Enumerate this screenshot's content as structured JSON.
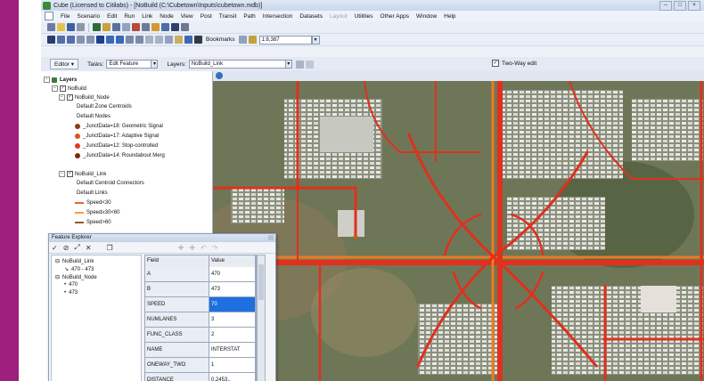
{
  "window": {
    "title": "Cube (Licensed to Citilabs) - [NoBuild (C:\\Cubetown\\Inputs\\cubetown.mdb)]"
  },
  "menu": [
    "File",
    "Scenario",
    "Edit",
    "Run",
    "Link",
    "Node",
    "View",
    "Post",
    "Transit",
    "Path",
    "Intersection",
    "Datasets",
    "Layout",
    "Utilities",
    "Other Apps",
    "Window",
    "Help"
  ],
  "menu_dim_index": 12,
  "toolbar": {
    "bookmarks_label": "Bookmarks",
    "scale_value": "1:8,387"
  },
  "editbar": {
    "editor_label": "Editor",
    "tasks_label": "Tasks:",
    "tasks_value": "Edit Feature",
    "layers_label": "Layers:",
    "layers_value": "NoBuild_Link",
    "two_way_label": "Two-Way edit"
  },
  "layers": {
    "root": "Layers",
    "group": "NoBuild",
    "node_layer": "NoBuild_Node",
    "node_items": [
      {
        "label": "Default Zone Centroids",
        "color": ""
      },
      {
        "label": "Default Nodes",
        "color": ""
      },
      {
        "label": "_JunctData=18: Geometric Signal",
        "color": "#8b3a1a"
      },
      {
        "label": "_JunctData=17: Adaptive Signal",
        "color": "#d2581c"
      },
      {
        "label": "_JunctData=12: Stop-controlled",
        "color": "#e03a1e"
      },
      {
        "label": "_JunctData=14: Roundabout Merg",
        "color": "#7a2a10"
      }
    ],
    "link_layer": "NoBuild_Link",
    "link_items": [
      {
        "label": "Default Centroid Connectors",
        "color": ""
      },
      {
        "label": "Default Links",
        "color": ""
      },
      {
        "label": "Speed<30",
        "color": "#e06a2a"
      },
      {
        "label": "Speed≥30<60",
        "color": "#f0a030"
      },
      {
        "label": "Speed>60",
        "color": "#a05030"
      }
    ]
  },
  "feature_explorer": {
    "title": "Feature Explorer",
    "tree": [
      {
        "label": "NoBuild_Link",
        "level": 0
      },
      {
        "label": "470 - 473",
        "level": 1
      },
      {
        "label": "NoBuild_Node",
        "level": 0
      },
      {
        "label": "470",
        "level": 1
      },
      {
        "label": "473",
        "level": 1
      }
    ],
    "grid_headers": [
      "Field",
      "Value"
    ],
    "rows": [
      {
        "field": "A",
        "value": "470"
      },
      {
        "field": "B",
        "value": "473"
      },
      {
        "field": "SPEED",
        "value": "70"
      },
      {
        "field": "NUMLANES",
        "value": "3"
      },
      {
        "field": "FUNC_CLASS",
        "value": "2"
      },
      {
        "field": "NAME",
        "value": "INTERSTAT"
      },
      {
        "field": "ONEWAY_TWO",
        "value": "1"
      },
      {
        "field": "DISTANCE",
        "value": "0.2453.."
      }
    ],
    "selected_row": 2
  },
  "colors": {
    "brand_strip": "#9e1f7d",
    "road_red": "#e0301e",
    "road_orange": "#f07a20",
    "selection_blue": "#1e6fe0"
  }
}
